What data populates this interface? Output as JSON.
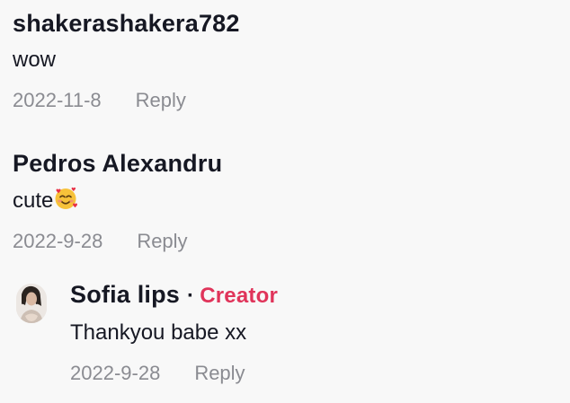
{
  "comments": [
    {
      "username": "shakerashakera782",
      "text": "wow",
      "date": "2022-11-8",
      "reply_label": "Reply"
    },
    {
      "username": "Pedros Alexandru",
      "text": "cute",
      "emoji": "smiling-face-with-hearts",
      "date": "2022-9-28",
      "reply_label": "Reply"
    }
  ],
  "reply": {
    "username": "Sofia lips",
    "separator": "·",
    "badge": "Creator",
    "text": "Thankyou babe xx",
    "date": "2022-9-28",
    "reply_label": "Reply"
  },
  "colors": {
    "creator_badge": "#e0345a",
    "meta_text": "#8a8b91",
    "primary_text": "#161823",
    "background": "#f8f8f8"
  }
}
